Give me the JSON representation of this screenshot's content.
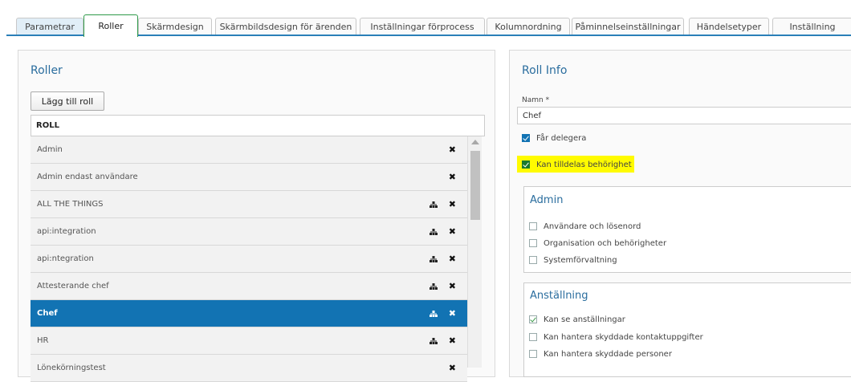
{
  "tabs": [
    {
      "label": "Parametrar"
    },
    {
      "label": "Roller"
    },
    {
      "label": "Skärmdesign"
    },
    {
      "label": "Skärmbildsdesign för ärenden"
    },
    {
      "label": "Inställningar förprocess"
    },
    {
      "label": "Kolumnordning"
    },
    {
      "label": "Påminnelseinställningar"
    },
    {
      "label": "Händelsetyper"
    },
    {
      "label": "Inställning"
    }
  ],
  "roles_panel": {
    "title": "Roller",
    "add_button": "Lägg till roll",
    "column_header": "ROLL",
    "rows": [
      {
        "name": "Admin",
        "org": false
      },
      {
        "name": "Admin endast användare",
        "org": false
      },
      {
        "name": "ALL THE THINGS",
        "org": true
      },
      {
        "name": "api:integration",
        "org": true
      },
      {
        "name": "api:ntegration",
        "org": true
      },
      {
        "name": "Attesterande chef",
        "org": true
      },
      {
        "name": "Chef",
        "org": true
      },
      {
        "name": "HR",
        "org": true
      },
      {
        "name": "Lönekörningstest",
        "org": false
      }
    ],
    "selected_index": 6
  },
  "info_panel": {
    "title": "Roll Info",
    "name_label": "Namn *",
    "name_value": "Chef",
    "delegate_label": "Får delegera",
    "assignable_label": "Kan tilldelas behörighet",
    "highlight_color": "#fffb00",
    "groups": [
      {
        "title": "Admin",
        "items": [
          {
            "label": "Användare och lösenord",
            "checked": false
          },
          {
            "label": "Organisation och behörigheter",
            "checked": false
          },
          {
            "label": "Systemförvaltning",
            "checked": false
          }
        ]
      },
      {
        "title": "Anställning",
        "items": [
          {
            "label": "Kan se anställningar",
            "checked": true
          },
          {
            "label": "Kan hantera skyddade kontaktuppgifter",
            "checked": false
          },
          {
            "label": "Kan hantera skyddade personer",
            "checked": false
          }
        ]
      }
    ]
  },
  "colors": {
    "accent": "#2a6d9e",
    "selected_row": "#1273b3",
    "active_tab_border": "#2f9a4a"
  }
}
